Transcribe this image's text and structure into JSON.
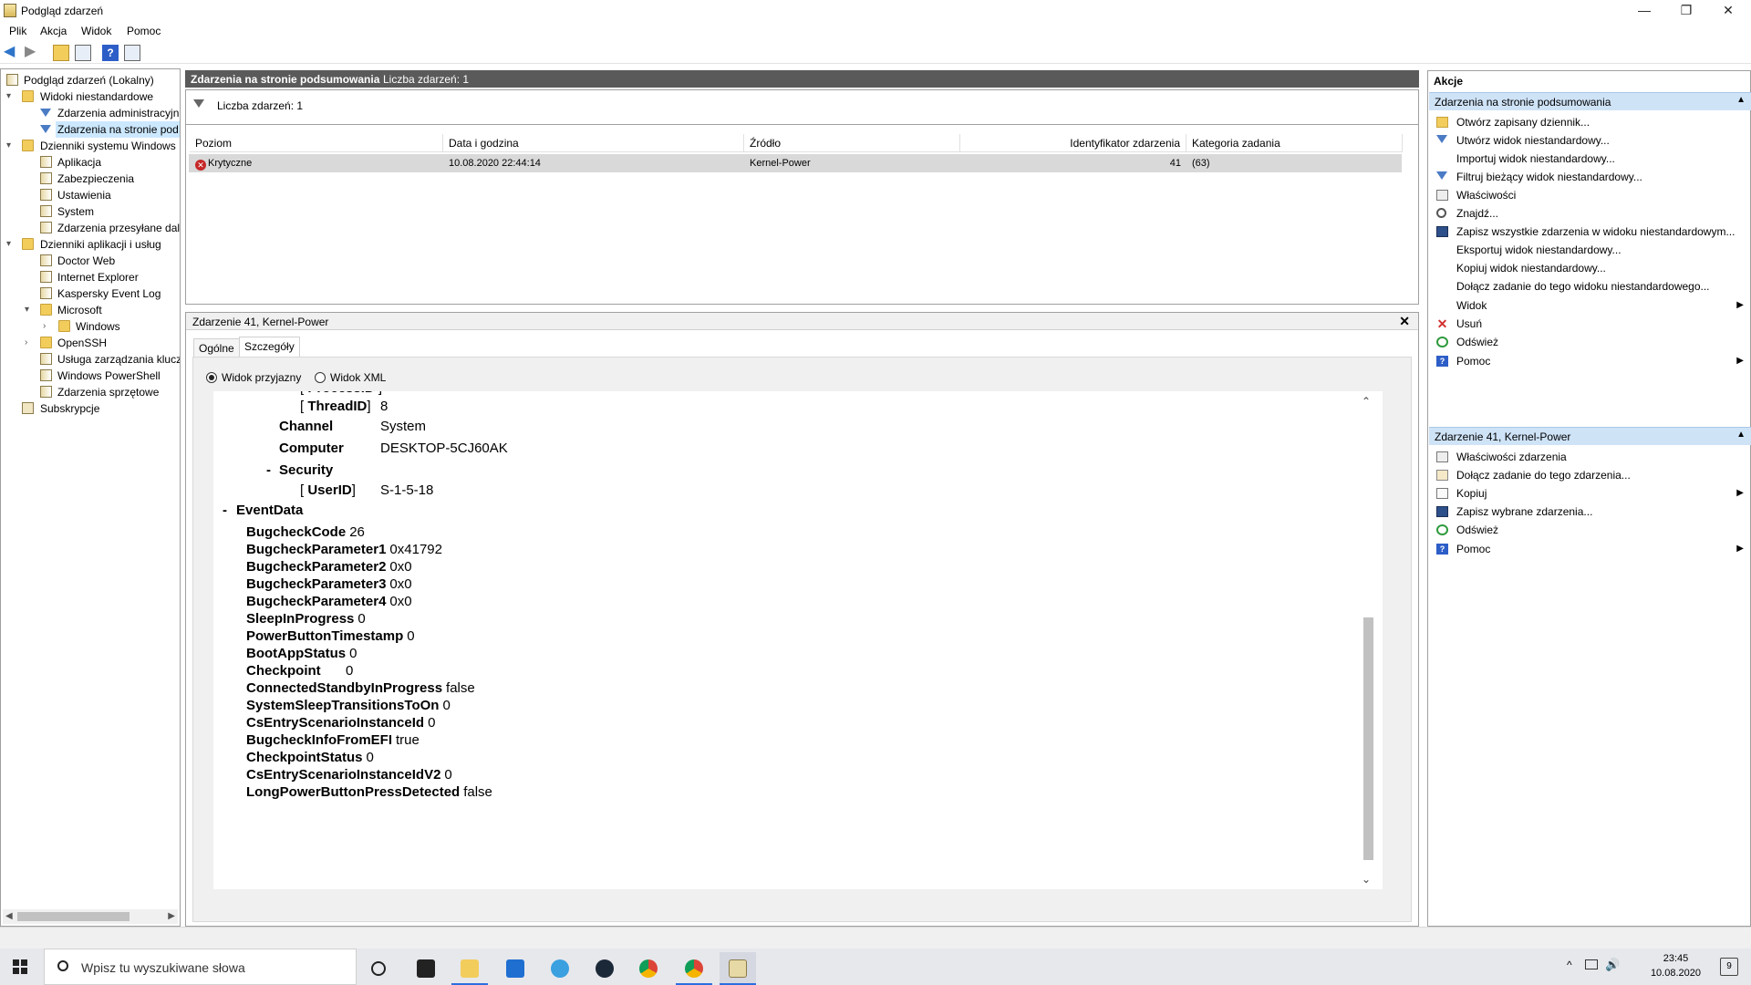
{
  "window": {
    "title": "Podgląd zdarzeń",
    "minimize": "—",
    "maximize": "❐",
    "close": "✕"
  },
  "menu": [
    "Plik",
    "Akcja",
    "Widok",
    "Pomoc"
  ],
  "tree": {
    "root": "Podgląd zdarzeń (Lokalny)",
    "custom_views": "Widoki niestandardowe",
    "admin_events": "Zdarzenia administracyjn",
    "summary_events": "Zdarzenia na stronie pod",
    "windows_logs": "Dzienniki systemu Windows",
    "app": "Aplikacja",
    "security": "Zabezpieczenia",
    "setup": "Ustawienia",
    "system": "System",
    "forwarded": "Zdarzenia przesyłane dale",
    "app_services": "Dzienniki aplikacji i usług",
    "doctorweb": "Doctor Web",
    "ie": "Internet Explorer",
    "kaspersky": "Kaspersky Event Log",
    "microsoft": "Microsoft",
    "windows": "Windows",
    "openssh": "OpenSSH",
    "keymgmt": "Usługa zarządzania klucz",
    "powershell": "Windows PowerShell",
    "hardware": "Zdarzenia sprzętowe",
    "subscriptions": "Subskrypcje"
  },
  "summary": {
    "title": "Zdarzenia na stronie podsumowania",
    "count_label": "Liczba zdarzeń: 1",
    "filter_label": "Liczba zdarzeń: 1"
  },
  "grid": {
    "headers": [
      "Poziom",
      "Data i godzina",
      "Źródło",
      "Identyfikator zdarzenia",
      "Kategoria zadania"
    ],
    "row": {
      "level": "Krytyczne",
      "datetime": "10.08.2020 22:44:14",
      "source": "Kernel-Power",
      "id": "41",
      "category": "(63)"
    }
  },
  "detail": {
    "title": "Zdarzenie 41, Kernel-Power",
    "close": "✕",
    "tabs": [
      "Ogólne",
      "Szczegóły"
    ],
    "radio_friendly": "Widok przyjazny",
    "radio_xml": "Widok XML",
    "system_rows": {
      "threadid_key": "ThreadID",
      "threadid_val": "8",
      "channel_key": "Channel",
      "channel_val": "System",
      "computer_key": "Computer",
      "computer_val": "DESKTOP-5CJ60AK",
      "security_key": "Security",
      "userid_key": "UserID",
      "userid_val": "S-1-5-18",
      "eventdata_key": "EventData",
      "minus": "-"
    },
    "eventdata": [
      {
        "k": "BugcheckCode",
        "v": "26"
      },
      {
        "k": "BugcheckParameter1",
        "v": "0x41792"
      },
      {
        "k": "BugcheckParameter2",
        "v": "0x0"
      },
      {
        "k": "BugcheckParameter3",
        "v": "0x0"
      },
      {
        "k": "BugcheckParameter4",
        "v": "0x0"
      },
      {
        "k": "SleepInProgress",
        "v": "0"
      },
      {
        "k": "PowerButtonTimestamp",
        "v": "0"
      },
      {
        "k": "BootAppStatus",
        "v": "0"
      },
      {
        "k": "Checkpoint",
        "v": "0"
      },
      {
        "k": "ConnectedStandbyInProgress",
        "v": "false"
      },
      {
        "k": "SystemSleepTransitionsToOn",
        "v": "0"
      },
      {
        "k": "CsEntryScenarioInstanceId",
        "v": "0"
      },
      {
        "k": "BugcheckInfoFromEFI",
        "v": "true"
      },
      {
        "k": "CheckpointStatus",
        "v": "0"
      },
      {
        "k": "CsEntryScenarioInstanceIdV2",
        "v": "0"
      },
      {
        "k": "LongPowerButtonPressDetected",
        "v": "false"
      }
    ]
  },
  "actions": {
    "title": "Akcje",
    "section1": "Zdarzenia na stronie podsumowania",
    "items1": [
      "Otwórz zapisany dziennik...",
      "Utwórz widok niestandardowy...",
      "Importuj widok niestandardowy...",
      "Filtruj bieżący widok niestandardowy...",
      "Właściwości",
      "Znajdź...",
      "Zapisz wszystkie zdarzenia w widoku niestandardowym...",
      "Eksportuj widok niestandardowy...",
      "Kopiuj widok niestandardowy...",
      "Dołącz zadanie do tego widoku niestandardowego...",
      "Widok",
      "Usuń",
      "Odśwież",
      "Pomoc"
    ],
    "section2": "Zdarzenie 41, Kernel-Power",
    "items2": [
      "Właściwości zdarzenia",
      "Dołącz zadanie do tego zdarzenia...",
      "Kopiuj",
      "Zapisz wybrane zdarzenia...",
      "Odśwież",
      "Pomoc"
    ]
  },
  "taskbar": {
    "search_placeholder": "Wpisz tu wyszukiwane słowa",
    "time": "23:45",
    "date": "10.08.2020",
    "notifications": "9"
  }
}
